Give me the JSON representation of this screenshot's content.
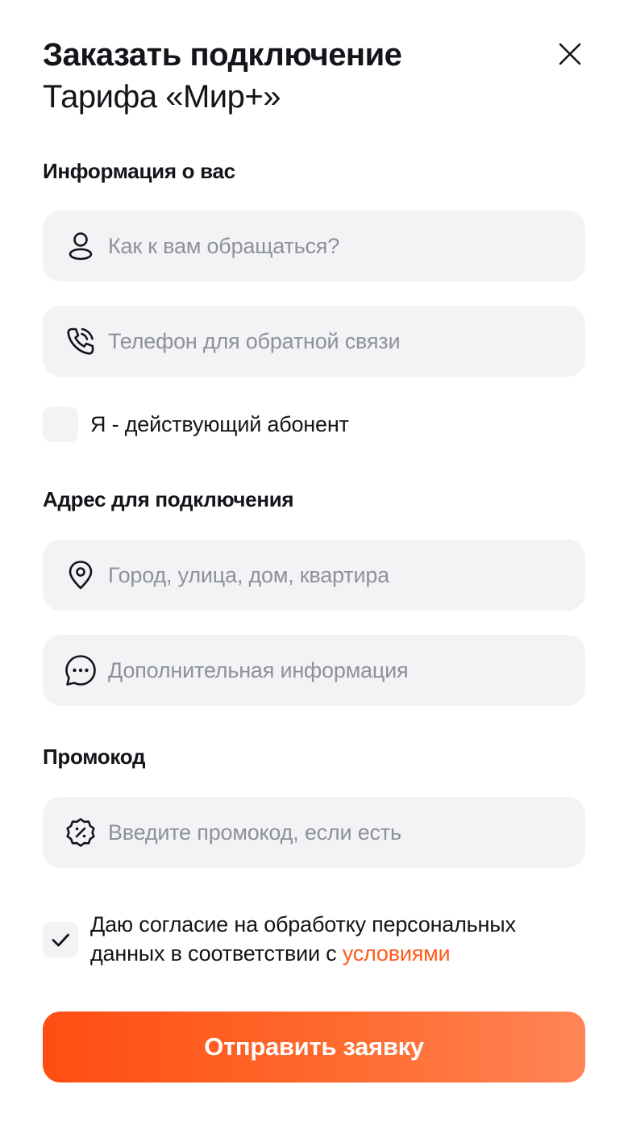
{
  "header": {
    "title": "Заказать подключение",
    "subtitle": "Тарифа «Мир+»"
  },
  "sections": {
    "about": "Информация о вас",
    "address": "Адрес для подключения",
    "promo": "Промокод"
  },
  "fields": {
    "name": {
      "placeholder": "Как к вам обращаться?",
      "value": "",
      "icon": "user-icon"
    },
    "phone": {
      "placeholder": "Телефон для обратной связи",
      "value": "",
      "icon": "phone-icon"
    },
    "address": {
      "placeholder": "Город, улица, дом, квартира",
      "value": "",
      "icon": "location-pin-icon"
    },
    "extra": {
      "placeholder": "Дополнительная информация",
      "value": "",
      "icon": "chat-bubble-icon"
    },
    "promo": {
      "placeholder": "Введите промокод, если есть",
      "value": "",
      "icon": "discount-badge-icon"
    }
  },
  "subscriber_checkbox": {
    "label": "Я - действующий абонент",
    "checked": false
  },
  "consent": {
    "text": "Даю согласие на обработку персональных данных в соответствии с ",
    "link_text": "условиями",
    "checked": true
  },
  "submit": {
    "label": "Отправить заявку"
  },
  "colors": {
    "accent": "#ff5a1a",
    "field_bg": "#f2f3f5",
    "placeholder": "#8e9199",
    "text": "#14151a"
  }
}
